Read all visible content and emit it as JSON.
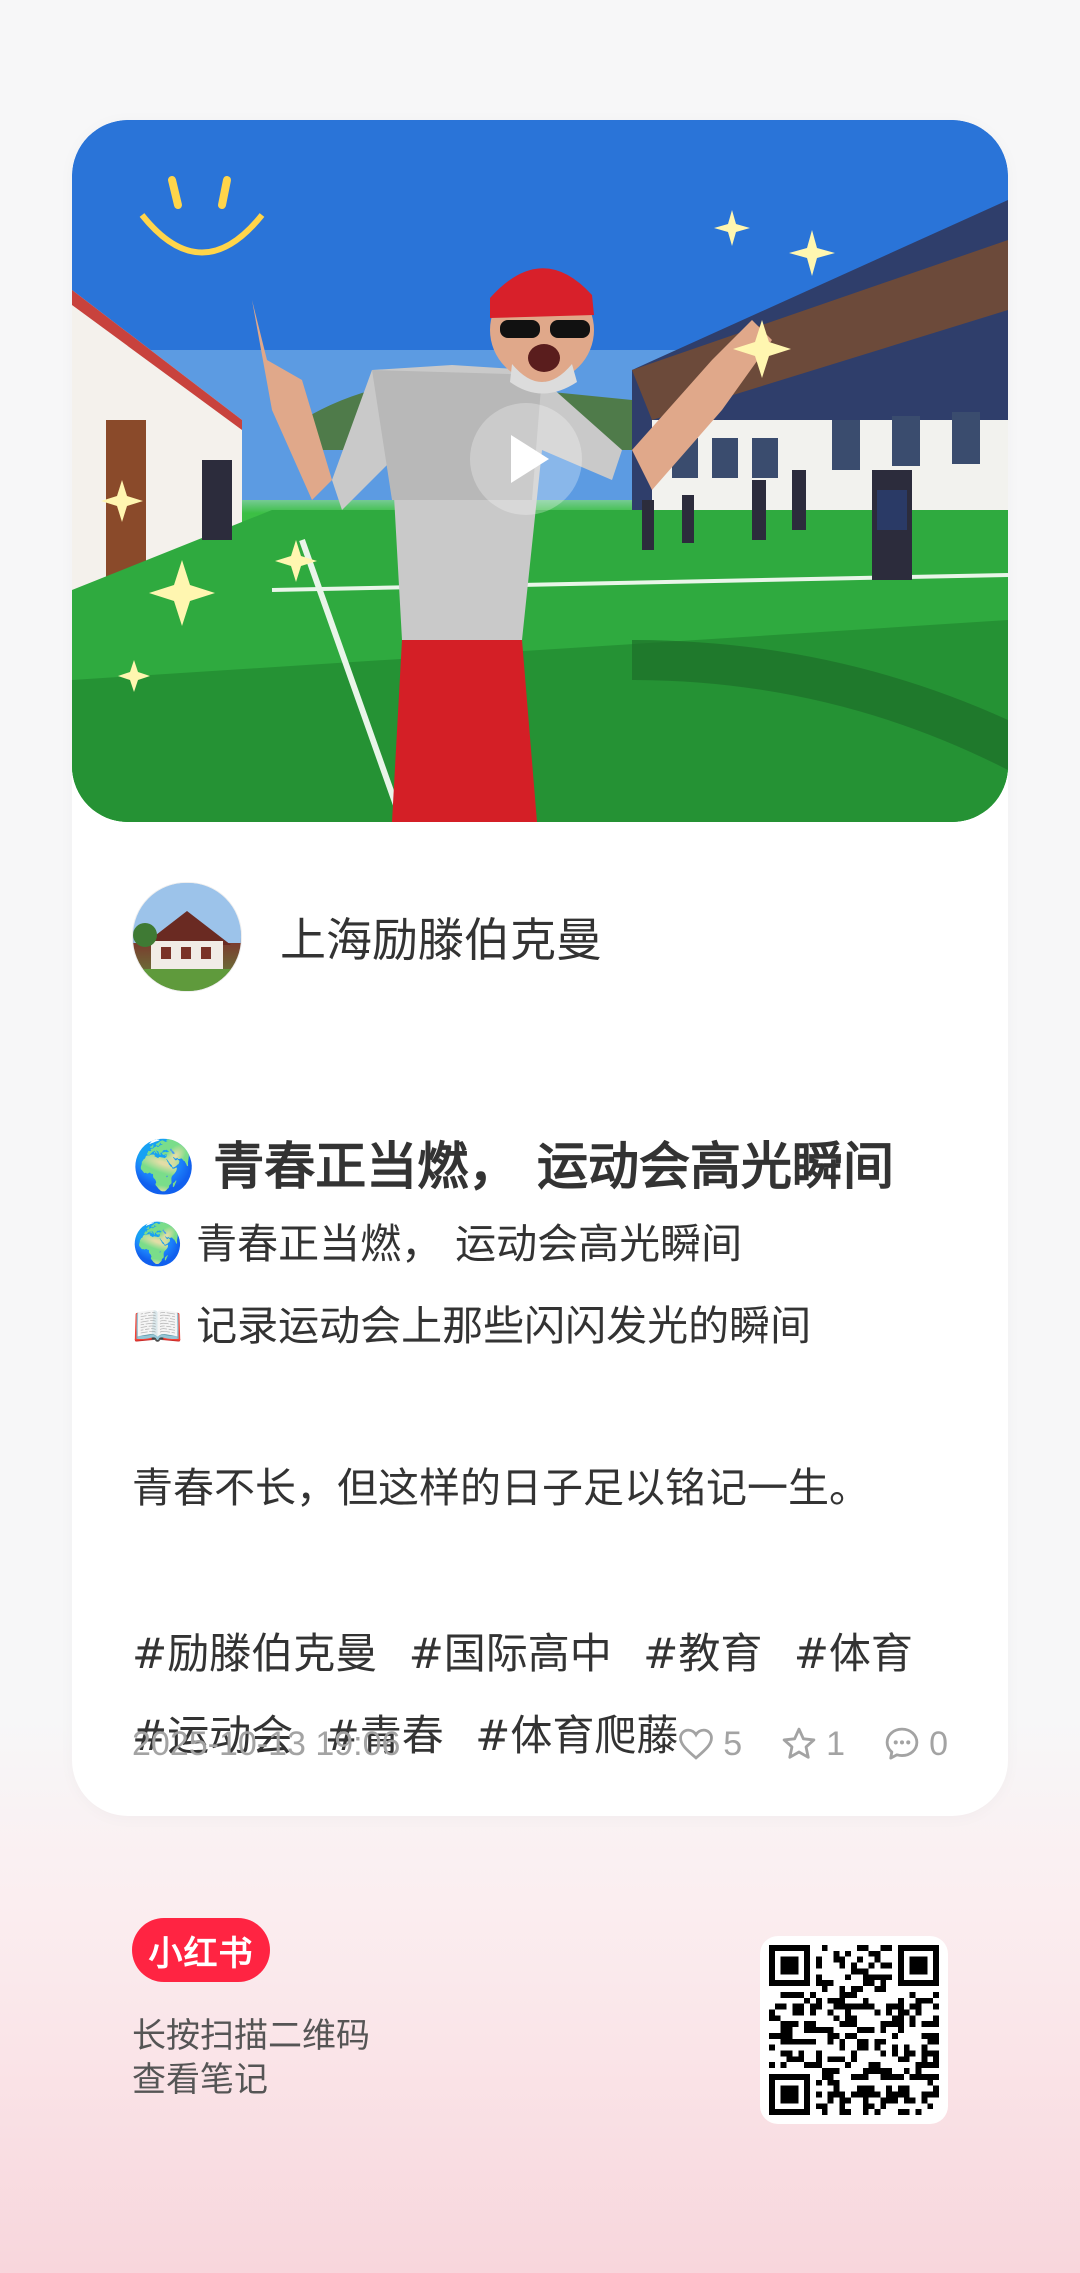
{
  "cover": {
    "play_icon": "play-icon"
  },
  "author": {
    "name": "上海励滕伯克曼"
  },
  "post": {
    "title_emoji": "🌍",
    "title": "青春正当燃， 运动会高光瞬间",
    "lines": [
      {
        "emoji": "🌍",
        "text": "青春正当燃， 运动会高光瞬间"
      },
      {
        "emoji": "📖",
        "text": "记录运动会上那些闪闪发光的瞬间"
      }
    ],
    "body": "青春不长，但这样的日子足以铭记一生。",
    "tags_line1": [
      "#励滕伯克曼",
      "#国际高中",
      "#教育",
      "#体育"
    ],
    "tags_line2": [
      "#运动会",
      "#青春",
      "#体育爬藤"
    ]
  },
  "meta": {
    "date": "2025-10-13 19:06",
    "likes": "5",
    "collects": "1",
    "comments": "0",
    "like_icon": "heart-icon",
    "collect_icon": "star-icon",
    "comment_icon": "comment-icon"
  },
  "footer": {
    "logo": "小红书",
    "scan_line1": "长按扫描二维码",
    "scan_line2": "查看笔记"
  },
  "colors": {
    "brand": "#ff2442",
    "meta_gray": "#a3a3a3"
  }
}
